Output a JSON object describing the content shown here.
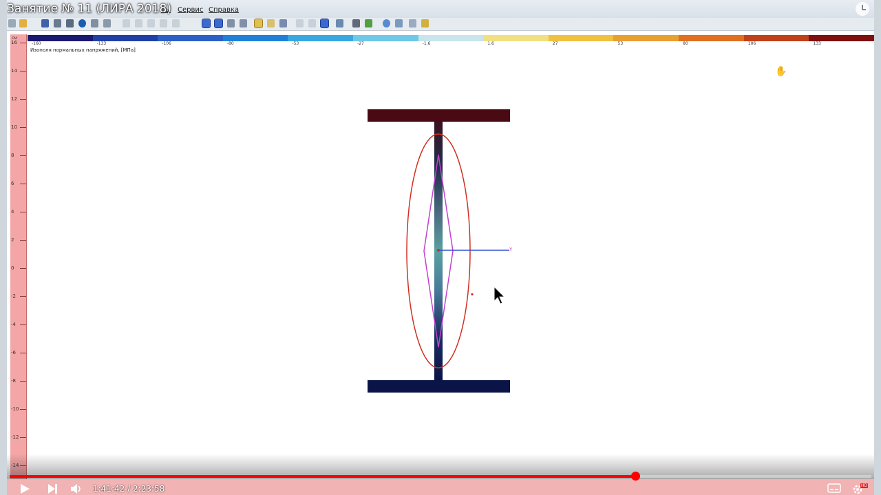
{
  "video": {
    "title": "Занятие № 11 (ЛИРА 2018)",
    "time_current": "1:41:42",
    "time_separator": "/",
    "time_total": "2:23:58",
    "progress_percent": 72.6,
    "hd_badge": "HD"
  },
  "menu": {
    "items": [
      "ты",
      "Сервис",
      "Справка"
    ]
  },
  "legend": {
    "title": "Изополя нормальных напряжений, [МПа]",
    "ticks": [
      "-160",
      "-133",
      "-106",
      "-80",
      "-53",
      "-27",
      "-1.6",
      "1.6",
      "27",
      "53",
      "80",
      "106",
      "133"
    ],
    "colors": [
      "#1a1870",
      "#2040a8",
      "#2a60c8",
      "#1f80d8",
      "#38a8e0",
      "#70c8e8",
      "#c8e4ec",
      "#f0e080",
      "#f0c040",
      "#e8a030",
      "#e07020",
      "#c04018",
      "#801010"
    ]
  },
  "ruler": {
    "unit": "см",
    "labels": [
      "16",
      "14",
      "12",
      "10",
      "8",
      "6",
      "4",
      "2",
      "0",
      "-2",
      "-4",
      "-6",
      "-8",
      "-10",
      "-12",
      "-14"
    ]
  },
  "axis": {
    "y_label": "Y"
  },
  "colors": {
    "top_flange": "#4a0a14",
    "bottom_flange": "#0a1446",
    "web": "#12203c",
    "ellipse": "#d03020",
    "diamond": "#c040d0",
    "axis_line": "#3050d0",
    "progress": "#ff0000"
  }
}
